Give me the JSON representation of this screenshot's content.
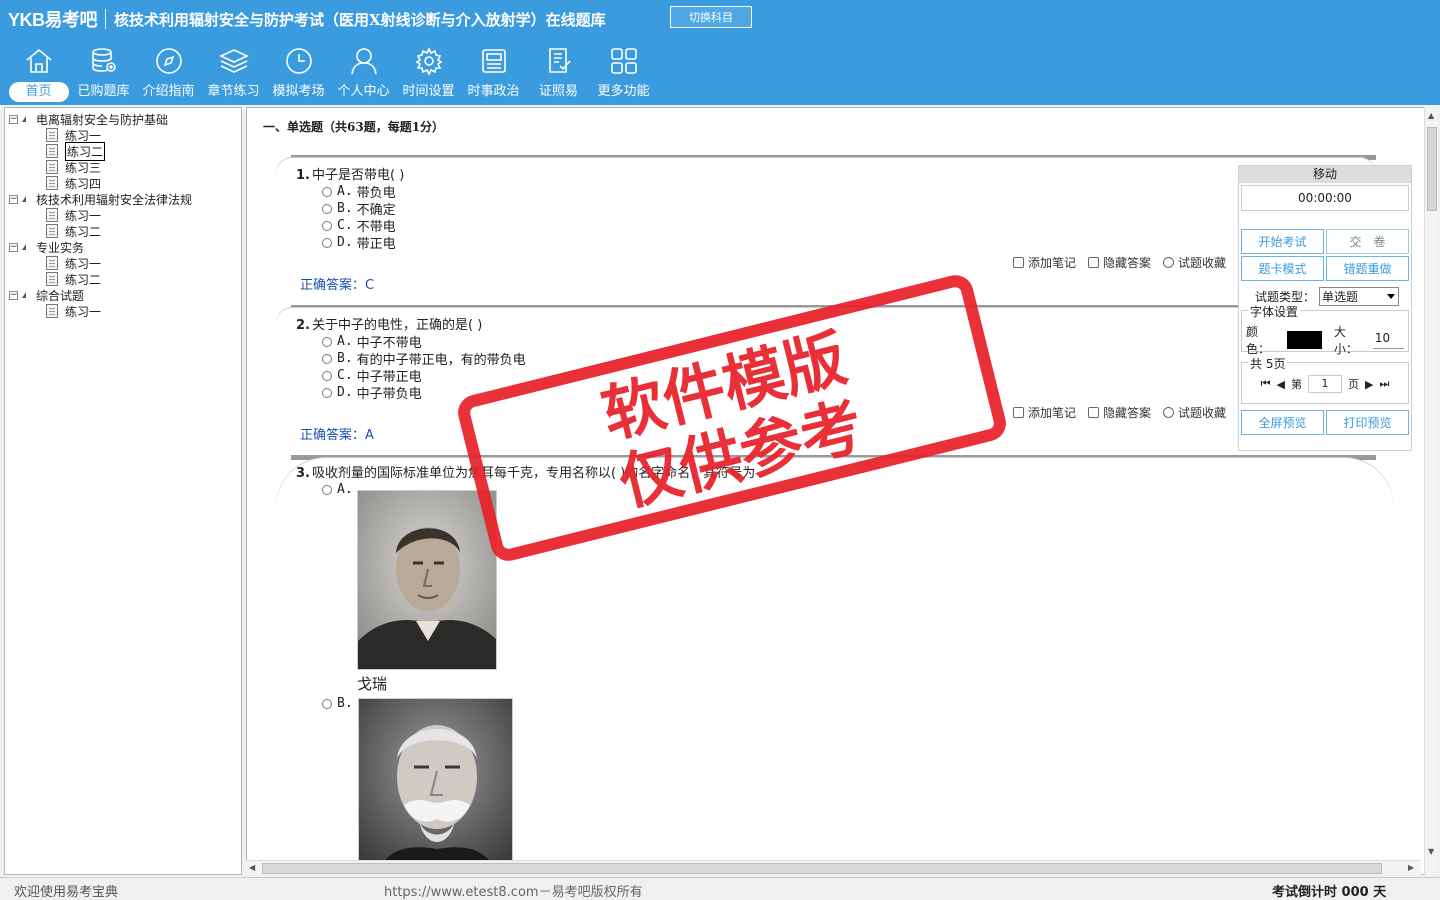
{
  "header": {
    "logo": "YKB易考吧",
    "title": "核技术利用辐射安全与防护考试（医用X射线诊断与介入放射学）在线题库",
    "switch_label": "切换科目"
  },
  "nav": [
    {
      "label": "首页",
      "icon": "home-icon",
      "active": true
    },
    {
      "label": "已购题库",
      "icon": "database-icon"
    },
    {
      "label": "介绍指南",
      "icon": "compass-icon"
    },
    {
      "label": "章节练习",
      "icon": "layers-icon"
    },
    {
      "label": "模拟考场",
      "icon": "clock-icon"
    },
    {
      "label": "个人中心",
      "icon": "user-icon"
    },
    {
      "label": "时间设置",
      "icon": "gear-icon"
    },
    {
      "label": "时事政治",
      "icon": "newspaper-icon"
    },
    {
      "label": "证照易",
      "icon": "certificate-icon"
    },
    {
      "label": "更多功能",
      "icon": "grid-icon"
    }
  ],
  "tree": [
    {
      "label": "电离辐射安全与防护基础",
      "children": [
        "练习一",
        "练习二",
        "练习三",
        "练习四"
      ]
    },
    {
      "label": "核技术利用辐射安全法律法规",
      "children": [
        "练习一",
        "练习二"
      ]
    },
    {
      "label": "专业实务",
      "children": [
        "练习一",
        "练习二"
      ]
    },
    {
      "label": "综合试题",
      "children": [
        "练习一"
      ]
    }
  ],
  "section_title": "一、单选题（共63题，每题1分）",
  "questions": [
    {
      "num": "1.",
      "stem": "中子是否带电( )",
      "options": [
        [
          "A.",
          "带负电"
        ],
        [
          "B.",
          "不确定"
        ],
        [
          "C.",
          "不带电"
        ],
        [
          "D.",
          "带正电"
        ]
      ],
      "answer_label": "正确答案：",
      "answer": "C"
    },
    {
      "num": "2.",
      "stem": "关于中子的电性，正确的是( )",
      "options": [
        [
          "A.",
          "中子不带电"
        ],
        [
          "B.",
          "有的中子带正电，有的带负电"
        ],
        [
          "C.",
          "中子带正电"
        ],
        [
          "D.",
          "中子带负电"
        ]
      ],
      "answer_label": "正确答案：",
      "answer": "A"
    },
    {
      "num": "3.",
      "stem": "吸收剂量的国际标准单位为焦耳每千克，专用名称以( )的名字命名，其符号为",
      "options": [
        [
          "A.",
          ""
        ],
        [
          "B.",
          ""
        ]
      ],
      "caption_a": "戈瑞"
    }
  ],
  "actions": {
    "note": "添加笔记",
    "hide": "隐藏答案",
    "fav": "试题收藏"
  },
  "panel": {
    "move": "移动",
    "timer": "00:00:00",
    "start": "开始考试",
    "submit": "交　卷",
    "card_mode": "题卡模式",
    "redo": "错题重做",
    "type_label": "试题类型：",
    "type_value": "单选题",
    "font_legend": "字体设置",
    "color_label": "颜色：",
    "size_label": "大小：",
    "size_value": "10",
    "pages_legend": "共 5页",
    "page_prefix": "第",
    "page_value": "1",
    "page_suffix": "页",
    "fullscreen": "全屏预览",
    "print": "打印预览"
  },
  "stamp": {
    "line1": "软件模版",
    "line2": "仅供参考",
    "color": "#e8202a"
  },
  "status": {
    "welcome": "欢迎使用易考宝典",
    "copyright": "https://www.etest8.com－易考吧版权所有",
    "countdown": "考试倒计时 000 天"
  },
  "colors": {
    "brand": "#3a9bdf",
    "answer": "#1a4fb0"
  }
}
